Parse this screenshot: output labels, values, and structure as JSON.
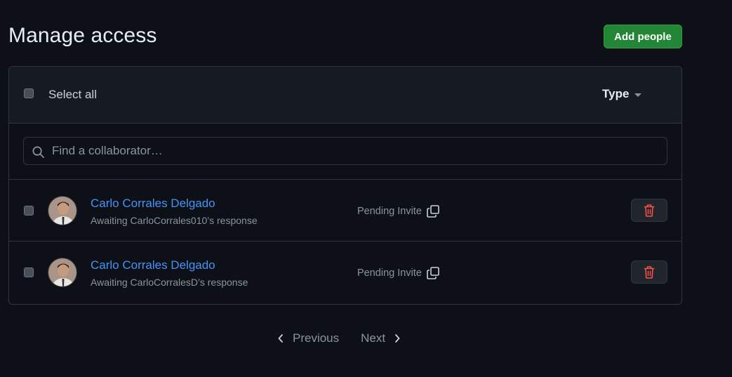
{
  "header": {
    "title": "Manage access",
    "add_people_label": "Add people"
  },
  "toolbar": {
    "select_all_label": "Select all",
    "type_filter_label": "Type"
  },
  "search": {
    "placeholder": "Find a collaborator…",
    "value": ""
  },
  "members": [
    {
      "name": "Carlo Corrales Delgado",
      "status": "Awaiting CarloCorrales010’s response",
      "invite_label": "Pending Invite"
    },
    {
      "name": "Carlo Corrales Delgado",
      "status": "Awaiting CarloCorralesD’s response",
      "invite_label": "Pending Invite"
    }
  ],
  "pagination": {
    "previous_label": "Previous",
    "next_label": "Next"
  },
  "icons": {
    "search": "search-icon",
    "copy": "copy-icon",
    "delete": "trash-icon",
    "caret": "caret-down-icon",
    "prev": "chevron-left-icon",
    "next": "chevron-right-icon"
  },
  "colors": {
    "background": "#0d1117",
    "primary_button": "#238636",
    "link": "#4493f8",
    "danger": "#f85149"
  }
}
